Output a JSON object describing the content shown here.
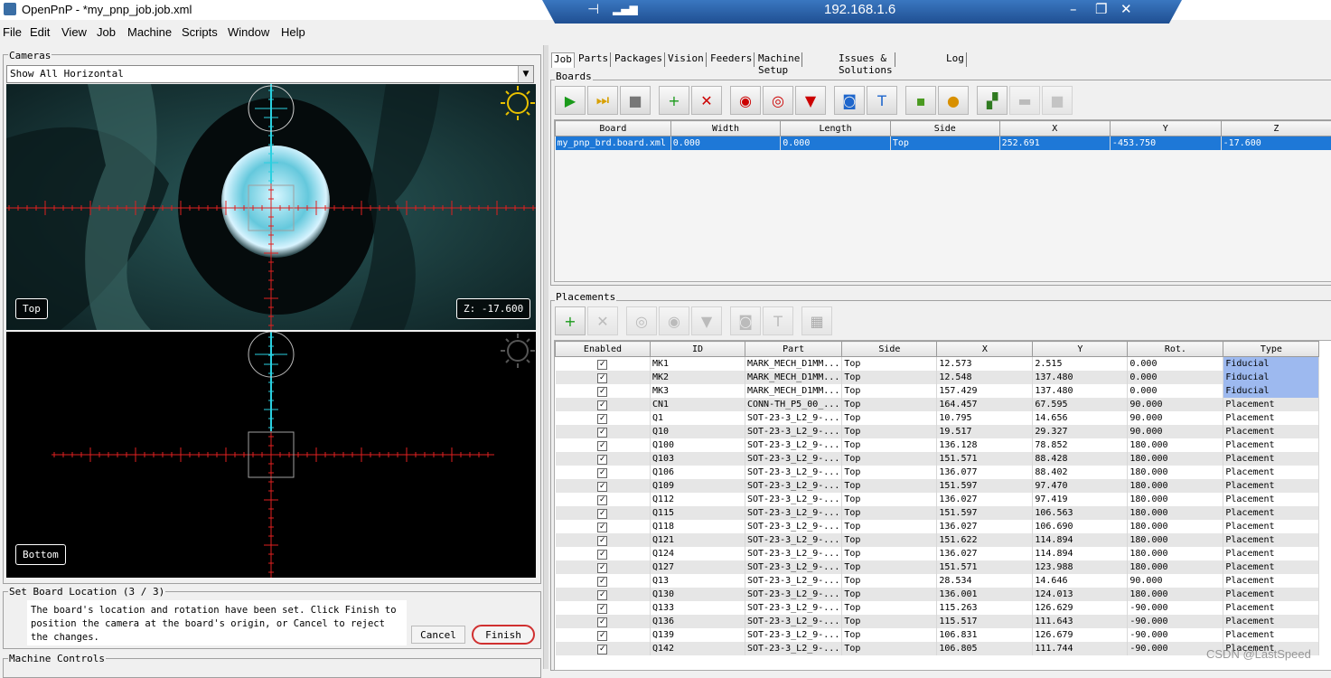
{
  "window": {
    "title": "OpenPnP - *my_pnp_job.job.xml"
  },
  "remote": {
    "host": "192.168.1.6"
  },
  "menu": [
    "File",
    "Edit",
    "View",
    "Job",
    "Machine",
    "Scripts",
    "Window",
    "Help"
  ],
  "cameras": {
    "title": "Cameras",
    "view_mode": "Show All Horizontal",
    "top_label": "Top",
    "z_readout": "Z: -17.600",
    "bottom_label": "Bottom"
  },
  "wizard": {
    "title": "Set Board Location (3 / 3)",
    "message": "The board's location and rotation have been set. Click Finish to position the camera at the board's origin, or Cancel to reject the changes.",
    "cancel": "Cancel",
    "finish": "Finish"
  },
  "machine_controls": {
    "title": "Machine Controls"
  },
  "tabs": [
    "Job",
    "Parts",
    "Packages",
    "Vision",
    "Feeders",
    "Machine Setup",
    "Issues & Solutions",
    "Log"
  ],
  "boards": {
    "title": "Boards",
    "toolbar": [
      {
        "icon": "play-icon",
        "glyph": "▶",
        "color": "#1a9a1a"
      },
      {
        "icon": "step-icon",
        "glyph": "⏭",
        "color": "#d8a000"
      },
      {
        "icon": "stop-icon",
        "glyph": "■",
        "color": "#777777"
      },
      {
        "icon": "add-icon",
        "glyph": "+",
        "color": "#1a9a1a"
      },
      {
        "icon": "remove-icon",
        "glyph": "✕",
        "color": "#cc0000"
      },
      {
        "icon": "capture-camera-icon",
        "glyph": "◉",
        "color": "#cc0000"
      },
      {
        "icon": "position-camera-icon",
        "glyph": "◎",
        "color": "#cc0000"
      },
      {
        "icon": "capture-tool-icon",
        "glyph": "▼",
        "color": "#cc0000"
      },
      {
        "icon": "fiducial-check-icon",
        "glyph": "◙",
        "color": "#1e66cc"
      },
      {
        "icon": "move-tool-icon",
        "glyph": "T",
        "color": "#1e66cc"
      },
      {
        "icon": "board-green-icon",
        "glyph": "▪",
        "color": "#4a9a20"
      },
      {
        "icon": "board-yellow-icon",
        "glyph": "●",
        "color": "#d89000"
      },
      {
        "icon": "panel-icon",
        "glyph": "▞",
        "color": "#2f7a20"
      },
      {
        "icon": "camera-disabled-icon",
        "glyph": "▬",
        "color": "#888888"
      },
      {
        "icon": "square-disabled-icon",
        "glyph": "■",
        "color": "#999999"
      }
    ],
    "columns": [
      "Board",
      "Width",
      "Length",
      "Side",
      "X",
      "Y",
      "Z"
    ],
    "rows": [
      [
        "my_pnp_brd.board.xml",
        "0.000",
        "0.000",
        "Top",
        "252.691",
        "-453.750",
        "-17.600"
      ]
    ]
  },
  "placements": {
    "title": "Placements",
    "toolbar": [
      {
        "icon": "add-icon",
        "glyph": "+",
        "color": "#1a9a1a"
      },
      {
        "icon": "remove-icon",
        "glyph": "✕",
        "color": "#888888"
      },
      {
        "icon": "position-camera-icon",
        "glyph": "◎",
        "color": "#888888"
      },
      {
        "icon": "capture-camera-icon",
        "glyph": "◉",
        "color": "#888888"
      },
      {
        "icon": "capture-tool-icon",
        "glyph": "▼",
        "color": "#888888"
      },
      {
        "icon": "fiducial-icon",
        "glyph": "◙",
        "color": "#888888"
      },
      {
        "icon": "move-tool-icon",
        "glyph": "T",
        "color": "#888888"
      },
      {
        "icon": "feeder-icon",
        "glyph": "▦",
        "color": "#666666"
      }
    ],
    "columns": [
      "Enabled",
      "ID",
      "Part",
      "Side",
      "X",
      "Y",
      "Rot.",
      "Type"
    ],
    "rows": [
      [
        "MK1",
        "MARK_MECH_D1MM...",
        "Top",
        "12.573",
        "2.515",
        "0.000",
        "Fiducial"
      ],
      [
        "MK2",
        "MARK_MECH_D1MM...",
        "Top",
        "12.548",
        "137.480",
        "0.000",
        "Fiducial"
      ],
      [
        "MK3",
        "MARK_MECH_D1MM...",
        "Top",
        "157.429",
        "137.480",
        "0.000",
        "Fiducial"
      ],
      [
        "CN1",
        "CONN-TH_P5_00_...",
        "Top",
        "164.457",
        "67.595",
        "90.000",
        "Placement"
      ],
      [
        "Q1",
        "SOT-23-3_L2_9-...",
        "Top",
        "10.795",
        "14.656",
        "90.000",
        "Placement"
      ],
      [
        "Q10",
        "SOT-23-3_L2_9-...",
        "Top",
        "19.517",
        "29.327",
        "90.000",
        "Placement"
      ],
      [
        "Q100",
        "SOT-23-3_L2_9-...",
        "Top",
        "136.128",
        "78.852",
        "180.000",
        "Placement"
      ],
      [
        "Q103",
        "SOT-23-3_L2_9-...",
        "Top",
        "151.571",
        "88.428",
        "180.000",
        "Placement"
      ],
      [
        "Q106",
        "SOT-23-3_L2_9-...",
        "Top",
        "136.077",
        "88.402",
        "180.000",
        "Placement"
      ],
      [
        "Q109",
        "SOT-23-3_L2_9-...",
        "Top",
        "151.597",
        "97.470",
        "180.000",
        "Placement"
      ],
      [
        "Q112",
        "SOT-23-3_L2_9-...",
        "Top",
        "136.027",
        "97.419",
        "180.000",
        "Placement"
      ],
      [
        "Q115",
        "SOT-23-3_L2_9-...",
        "Top",
        "151.597",
        "106.563",
        "180.000",
        "Placement"
      ],
      [
        "Q118",
        "SOT-23-3_L2_9-...",
        "Top",
        "136.027",
        "106.690",
        "180.000",
        "Placement"
      ],
      [
        "Q121",
        "SOT-23-3_L2_9-...",
        "Top",
        "151.622",
        "114.894",
        "180.000",
        "Placement"
      ],
      [
        "Q124",
        "SOT-23-3_L2_9-...",
        "Top",
        "136.027",
        "114.894",
        "180.000",
        "Placement"
      ],
      [
        "Q127",
        "SOT-23-3_L2_9-...",
        "Top",
        "151.571",
        "123.988",
        "180.000",
        "Placement"
      ],
      [
        "Q13",
        "SOT-23-3_L2_9-...",
        "Top",
        "28.534",
        "14.646",
        "90.000",
        "Placement"
      ],
      [
        "Q130",
        "SOT-23-3_L2_9-...",
        "Top",
        "136.001",
        "124.013",
        "180.000",
        "Placement"
      ],
      [
        "Q133",
        "SOT-23-3_L2_9-...",
        "Top",
        "115.263",
        "126.629",
        "-90.000",
        "Placement"
      ],
      [
        "Q136",
        "SOT-23-3_L2_9-...",
        "Top",
        "115.517",
        "111.643",
        "-90.000",
        "Placement"
      ],
      [
        "Q139",
        "SOT-23-3_L2_9-...",
        "Top",
        "106.831",
        "126.679",
        "-90.000",
        "Placement"
      ],
      [
        "Q142",
        "SOT-23-3_L2_9-...",
        "Top",
        "106.805",
        "111.744",
        "-90.000",
        "Placement"
      ]
    ]
  },
  "watermark": "CSDN @LastSpeed"
}
